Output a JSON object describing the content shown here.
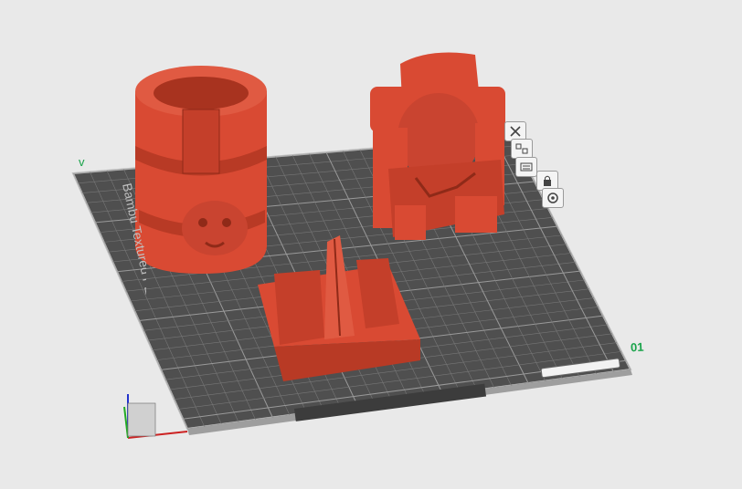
{
  "viewport": {
    "background": "#e9e9e9",
    "plate_number": "01",
    "corner_mark": "v",
    "bed_label": "Bambu Textured PEI Plate"
  },
  "plate_toolbar": [
    {
      "icon": "close-icon"
    },
    {
      "icon": "arrange-icon"
    },
    {
      "icon": "orient-icon"
    },
    {
      "icon": "lock-icon"
    },
    {
      "icon": "settings-icon"
    }
  ],
  "colors": {
    "model": "#d94a33",
    "model_shadow": "#a8331f",
    "grid_fill": "#4f4f4f",
    "grid_line": "#8a8a8a",
    "bed_edge": "#bdbdbd",
    "accent_green": "#19a34a"
  },
  "models": [
    {
      "name": "aztec-cup"
    },
    {
      "name": "aztec-throne-figure"
    },
    {
      "name": "aztec-obelisk-base"
    }
  ]
}
